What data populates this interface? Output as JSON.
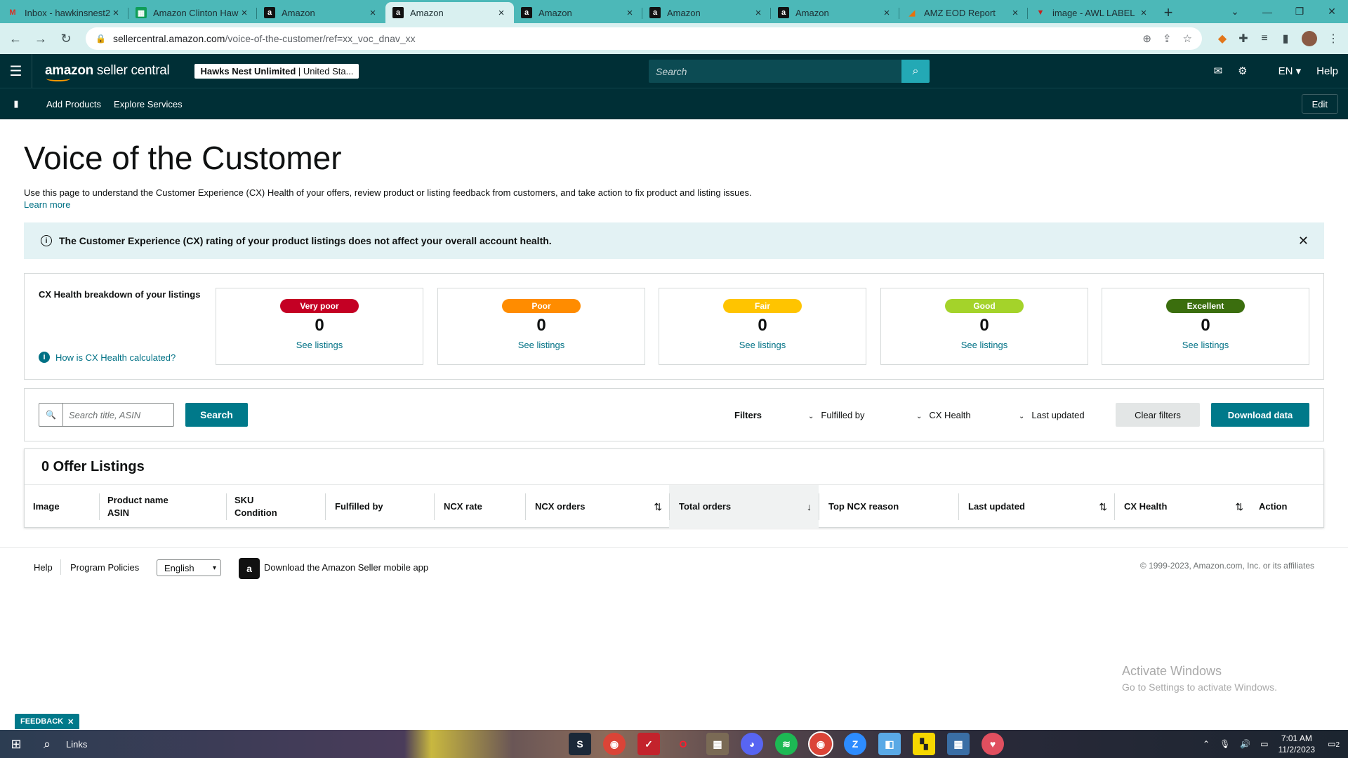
{
  "browser": {
    "tabs": [
      {
        "title": "Inbox - hawkinsnest2",
        "favicon": "gmail-icon"
      },
      {
        "title": "Amazon Clinton Hawk",
        "favicon": "sheets-icon"
      },
      {
        "title": "Amazon",
        "favicon": "amazon-icon"
      },
      {
        "title": "Amazon",
        "favicon": "amazon-icon",
        "active": true
      },
      {
        "title": "Amazon",
        "favicon": "amazon-icon"
      },
      {
        "title": "Amazon",
        "favicon": "amazon-icon"
      },
      {
        "title": "Amazon",
        "favicon": "amazon-icon"
      },
      {
        "title": "AMZ EOD Report",
        "favicon": "report-icon"
      },
      {
        "title": "image - AWL LABEL",
        "favicon": "label-icon"
      }
    ],
    "url_domain": "sellercentral.amazon.com",
    "url_path": "/voice-of-the-customer/ref=xx_voc_dnav_xx"
  },
  "header": {
    "logo_bold": "amazon",
    "logo_light": " seller central",
    "account_name": "Hawks Nest Unlimited",
    "account_region": " | United Sta...",
    "search_placeholder": "Search",
    "language": "EN",
    "help": "Help"
  },
  "nav": {
    "items": [
      "Add Products",
      "Explore Services"
    ],
    "edit": "Edit"
  },
  "page": {
    "title": "Voice of the Customer",
    "description": "Use this page to understand the Customer Experience (CX) Health of your offers, review product or listing feedback from customers, and take action to fix product and listing issues.",
    "learn_more": "Learn more",
    "banner": "The Customer Experience (CX) rating of your product listings does not affect your overall account health."
  },
  "cx_health": {
    "title": "CX Health breakdown of your listings",
    "how_link": "How is CX Health calculated?",
    "categories": [
      {
        "label": "Very poor",
        "count": "0",
        "link": "See listings",
        "color": "#c40024",
        "text_color": "#ffffff"
      },
      {
        "label": "Poor",
        "count": "0",
        "link": "See listings",
        "color": "#ff8c00",
        "text_color": "#ffffff"
      },
      {
        "label": "Fair",
        "count": "0",
        "link": "See listings",
        "color": "#ffc400",
        "text_color": "#ffffff"
      },
      {
        "label": "Good",
        "count": "0",
        "link": "See listings",
        "color": "#a4d32a",
        "text_color": "#ffffff"
      },
      {
        "label": "Excellent",
        "count": "0",
        "link": "See listings",
        "color": "#3b6e0e",
        "text_color": "#ffffff"
      }
    ]
  },
  "filters": {
    "search_placeholder": "Search title, ASIN",
    "search_button": "Search",
    "label": "Filters",
    "fulfilled_by": "Fulfilled by",
    "cx_health": "CX Health",
    "last_updated": "Last updated",
    "clear": "Clear filters",
    "download": "Download data"
  },
  "listings": {
    "title": "0 Offer Listings",
    "columns": [
      {
        "line1": "Image",
        "line2": ""
      },
      {
        "line1": "Product name",
        "line2": "ASIN"
      },
      {
        "line1": "SKU",
        "line2": "Condition"
      },
      {
        "line1": "Fulfilled by",
        "line2": ""
      },
      {
        "line1": "NCX rate",
        "line2": ""
      },
      {
        "line1": "NCX orders",
        "line2": ""
      },
      {
        "line1": "Total orders",
        "line2": ""
      },
      {
        "line1": "Top NCX reason",
        "line2": ""
      },
      {
        "line1": "Last updated",
        "line2": ""
      },
      {
        "line1": "CX Health",
        "line2": ""
      },
      {
        "line1": "Action",
        "line2": ""
      }
    ]
  },
  "footer": {
    "help": "Help",
    "policies": "Program Policies",
    "language": "English",
    "app": "Download the Amazon Seller mobile app",
    "copyright": "© 1999-2023, Amazon.com, Inc. or its affiliates"
  },
  "watermark": {
    "line1": "Activate Windows",
    "line2": "Go to Settings to activate Windows."
  },
  "feedback": "FEEDBACK",
  "taskbar": {
    "links": "Links",
    "time": "7:01 AM",
    "date": "11/2/2023",
    "notifications": "2"
  }
}
